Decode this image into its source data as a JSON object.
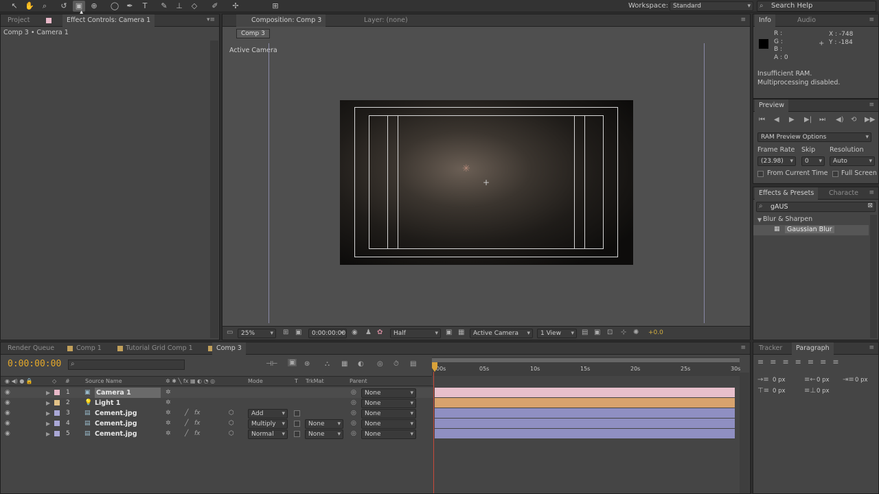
{
  "toolbar": {
    "workspace_label": "Workspace:",
    "workspace_value": "Standard",
    "search_placeholder": "Search Help"
  },
  "left_panel": {
    "tabs": [
      "Project",
      "Effect Controls: Camera 1"
    ],
    "subtitle": "Comp 3 • Camera 1"
  },
  "comp_panel": {
    "tabs": [
      "Composition: Comp 3",
      "Layer: (none)"
    ],
    "breadcrumb": "Comp 3",
    "view_label": "Active Camera",
    "footer": {
      "zoom": "25%",
      "timecode": "0:00:00:00",
      "resolution": "Half",
      "camera": "Active Camera",
      "views": "1 View",
      "exposure": "+0.0"
    }
  },
  "info": {
    "tabs": [
      "Info",
      "Audio"
    ],
    "r": "R :",
    "g": "G :",
    "b": "B :",
    "a": "A : 0",
    "x": "X : -748",
    "y": "Y : -184",
    "message1": "Insufficient RAM.",
    "message2": "Multiprocessing disabled."
  },
  "preview": {
    "tab": "Preview",
    "ram_options": "RAM Preview Options",
    "frame_rate_label": "Frame Rate",
    "skip_label": "Skip",
    "resolution_label": "Resolution",
    "frame_rate": "(23.98)",
    "skip": "0",
    "resolution": "Auto",
    "from_current": "From Current Time",
    "full_screen": "Full Screen"
  },
  "effects": {
    "tabs": [
      "Effects & Presets",
      "Characte"
    ],
    "search": "gAUS",
    "category": "Blur & Sharpen",
    "item": "Gaussian Blur"
  },
  "timeline": {
    "tabs": [
      "Render Queue",
      "Comp 1",
      "Tutorial Grid Comp 1",
      "Comp 3"
    ],
    "timecode": "0:00:00:00",
    "headers": {
      "source": "Source Name",
      "mode": "Mode",
      "t": "T",
      "trkmat": "TrkMat",
      "parent": "Parent"
    },
    "ruler": [
      "00s",
      "05s",
      "10s",
      "15s",
      "20s",
      "25s",
      "30s"
    ],
    "layers": [
      {
        "num": "1",
        "name": "Camera 1",
        "mode": "",
        "trkmat": "",
        "parent": "None",
        "color": "#e8b8c8",
        "bar": "#e8c0cc"
      },
      {
        "num": "2",
        "name": "Light 1",
        "mode": "",
        "trkmat": "",
        "parent": "None",
        "color": "#e2c287",
        "bar": "#d8a36e"
      },
      {
        "num": "3",
        "name": "Cement.jpg",
        "mode": "Add",
        "trkmat": "",
        "parent": "None",
        "color": "#a9a7d6",
        "bar": "#8f8fc2"
      },
      {
        "num": "4",
        "name": "Cement.jpg",
        "mode": "Multiply",
        "trkmat": "None",
        "parent": "None",
        "color": "#a9a7d6",
        "bar": "#8f8fc2"
      },
      {
        "num": "5",
        "name": "Cement.jpg",
        "mode": "Normal",
        "trkmat": "None",
        "parent": "None",
        "color": "#a9a7d6",
        "bar": "#8f8fc2"
      }
    ]
  },
  "right_bottom": {
    "tabs": [
      "Tracker",
      "Paragraph"
    ],
    "px1": "0 px",
    "px2": "0 px",
    "px3": "0 px",
    "px4": "0 px",
    "px5": "0 px"
  }
}
